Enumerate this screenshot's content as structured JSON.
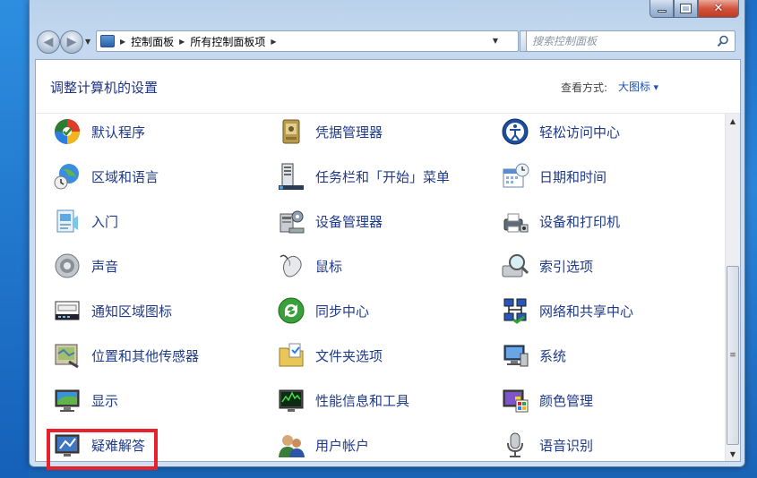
{
  "window": {
    "caption_close": "✕"
  },
  "address_bar": {
    "crumbs": [
      "控制面板",
      "所有控制面板项"
    ]
  },
  "search": {
    "placeholder": "搜索控制面板"
  },
  "header": {
    "title": "调整计算机的设置",
    "view_by_label": "查看方式:",
    "view_by_value": "大图标"
  },
  "items": [
    {
      "label": "默认程序",
      "icon": "default-programs-icon"
    },
    {
      "label": "凭据管理器",
      "icon": "credential-manager-icon"
    },
    {
      "label": "轻松访问中心",
      "icon": "ease-of-access-icon"
    },
    {
      "label": "区域和语言",
      "icon": "region-language-icon"
    },
    {
      "label": "任务栏和「开始」菜单",
      "icon": "taskbar-icon"
    },
    {
      "label": "日期和时间",
      "icon": "date-time-icon"
    },
    {
      "label": "入门",
      "icon": "getting-started-icon"
    },
    {
      "label": "设备管理器",
      "icon": "device-manager-icon"
    },
    {
      "label": "设备和打印机",
      "icon": "devices-printers-icon"
    },
    {
      "label": "声音",
      "icon": "sound-icon"
    },
    {
      "label": "鼠标",
      "icon": "mouse-icon"
    },
    {
      "label": "索引选项",
      "icon": "indexing-options-icon"
    },
    {
      "label": "通知区域图标",
      "icon": "notification-area-icon"
    },
    {
      "label": "同步中心",
      "icon": "sync-center-icon"
    },
    {
      "label": "网络和共享中心",
      "icon": "network-sharing-icon"
    },
    {
      "label": "位置和其他传感器",
      "icon": "location-sensors-icon"
    },
    {
      "label": "文件夹选项",
      "icon": "folder-options-icon"
    },
    {
      "label": "系统",
      "icon": "system-icon"
    },
    {
      "label": "显示",
      "icon": "display-icon"
    },
    {
      "label": "性能信息和工具",
      "icon": "performance-icon"
    },
    {
      "label": "颜色管理",
      "icon": "color-management-icon"
    },
    {
      "label": "疑难解答",
      "icon": "troubleshooting-icon"
    },
    {
      "label": "用户帐户",
      "icon": "user-accounts-icon"
    },
    {
      "label": "语音识别",
      "icon": "speech-recognition-icon"
    }
  ],
  "highlight_item": "显示",
  "colors": {
    "link": "#1f3a88",
    "title": "#1e3287",
    "highlight": "#e8202a"
  }
}
